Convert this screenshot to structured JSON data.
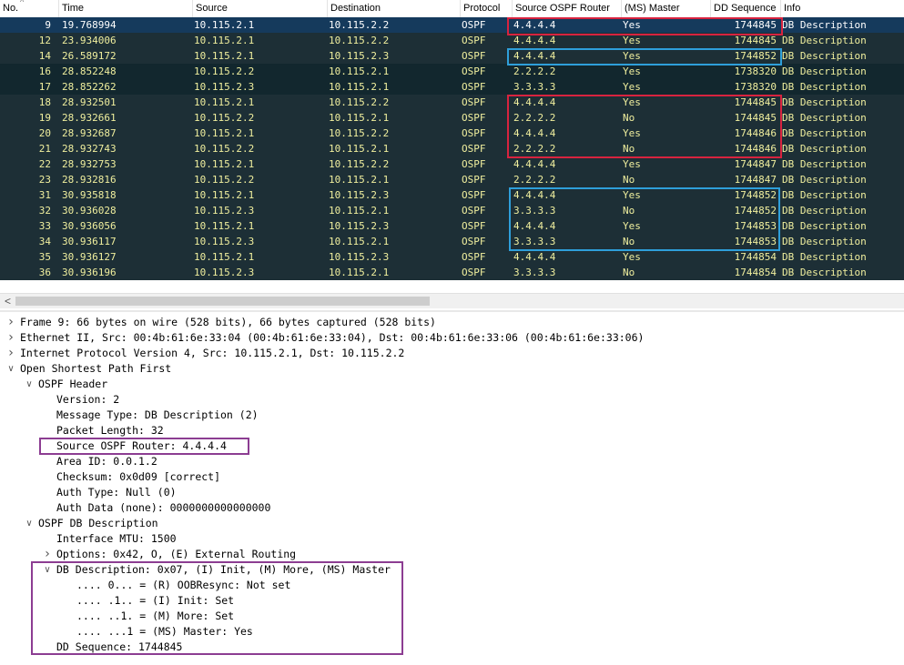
{
  "columns": [
    {
      "key": "no",
      "label": "No."
    },
    {
      "key": "time",
      "label": "Time"
    },
    {
      "key": "src",
      "label": "Source"
    },
    {
      "key": "dst",
      "label": "Destination"
    },
    {
      "key": "proto",
      "label": "Protocol"
    },
    {
      "key": "router",
      "label": "Source OSPF Router"
    },
    {
      "key": "master",
      "label": "(MS) Master"
    },
    {
      "key": "seq",
      "label": "DD Sequence"
    },
    {
      "key": "info",
      "label": "Info"
    }
  ],
  "packets": [
    {
      "no": "9",
      "time": "19.768994",
      "src": "10.115.2.1",
      "dst": "10.115.2.2",
      "proto": "OSPF",
      "router": "4.4.4.4",
      "master": "Yes",
      "seq": "1744845",
      "info": "DB Description",
      "style": "sel"
    },
    {
      "no": "12",
      "time": "23.934006",
      "src": "10.115.2.1",
      "dst": "10.115.2.2",
      "proto": "OSPF",
      "router": "4.4.4.4",
      "master": "Yes",
      "seq": "1744845",
      "info": "DB Description",
      "style": "mid"
    },
    {
      "no": "14",
      "time": "26.589172",
      "src": "10.115.2.1",
      "dst": "10.115.2.3",
      "proto": "OSPF",
      "router": "4.4.4.4",
      "master": "Yes",
      "seq": "1744852",
      "info": "DB Description",
      "style": "mid"
    },
    {
      "no": "16",
      "time": "28.852248",
      "src": "10.115.2.2",
      "dst": "10.115.2.1",
      "proto": "OSPF",
      "router": "2.2.2.2",
      "master": "Yes",
      "seq": "1738320",
      "info": "DB Description",
      "style": "dark"
    },
    {
      "no": "17",
      "time": "28.852262",
      "src": "10.115.2.3",
      "dst": "10.115.2.1",
      "proto": "OSPF",
      "router": "3.3.3.3",
      "master": "Yes",
      "seq": "1738320",
      "info": "DB Description",
      "style": "dark"
    },
    {
      "no": "18",
      "time": "28.932501",
      "src": "10.115.2.1",
      "dst": "10.115.2.2",
      "proto": "OSPF",
      "router": "4.4.4.4",
      "master": "Yes",
      "seq": "1744845",
      "info": "DB Description",
      "style": "mid"
    },
    {
      "no": "19",
      "time": "28.932661",
      "src": "10.115.2.2",
      "dst": "10.115.2.1",
      "proto": "OSPF",
      "router": "2.2.2.2",
      "master": "No",
      "seq": "1744845",
      "info": "DB Description",
      "style": "mid"
    },
    {
      "no": "20",
      "time": "28.932687",
      "src": "10.115.2.1",
      "dst": "10.115.2.2",
      "proto": "OSPF",
      "router": "4.4.4.4",
      "master": "Yes",
      "seq": "1744846",
      "info": "DB Description",
      "style": "mid"
    },
    {
      "no": "21",
      "time": "28.932743",
      "src": "10.115.2.2",
      "dst": "10.115.2.1",
      "proto": "OSPF",
      "router": "2.2.2.2",
      "master": "No",
      "seq": "1744846",
      "info": "DB Description",
      "style": "mid"
    },
    {
      "no": "22",
      "time": "28.932753",
      "src": "10.115.2.1",
      "dst": "10.115.2.2",
      "proto": "OSPF",
      "router": "4.4.4.4",
      "master": "Yes",
      "seq": "1744847",
      "info": "DB Description",
      "style": "mid"
    },
    {
      "no": "23",
      "time": "28.932816",
      "src": "10.115.2.2",
      "dst": "10.115.2.1",
      "proto": "OSPF",
      "router": "2.2.2.2",
      "master": "No",
      "seq": "1744847",
      "info": "DB Description",
      "style": "mid"
    },
    {
      "no": "31",
      "time": "30.935818",
      "src": "10.115.2.1",
      "dst": "10.115.2.3",
      "proto": "OSPF",
      "router": "4.4.4.4",
      "master": "Yes",
      "seq": "1744852",
      "info": "DB Description",
      "style": "mid"
    },
    {
      "no": "32",
      "time": "30.936028",
      "src": "10.115.2.3",
      "dst": "10.115.2.1",
      "proto": "OSPF",
      "router": "3.3.3.3",
      "master": "No",
      "seq": "1744852",
      "info": "DB Description",
      "style": "mid"
    },
    {
      "no": "33",
      "time": "30.936056",
      "src": "10.115.2.1",
      "dst": "10.115.2.3",
      "proto": "OSPF",
      "router": "4.4.4.4",
      "master": "Yes",
      "seq": "1744853",
      "info": "DB Description",
      "style": "mid"
    },
    {
      "no": "34",
      "time": "30.936117",
      "src": "10.115.2.3",
      "dst": "10.115.2.1",
      "proto": "OSPF",
      "router": "3.3.3.3",
      "master": "No",
      "seq": "1744853",
      "info": "DB Description",
      "style": "mid"
    },
    {
      "no": "35",
      "time": "30.936127",
      "src": "10.115.2.1",
      "dst": "10.115.2.3",
      "proto": "OSPF",
      "router": "4.4.4.4",
      "master": "Yes",
      "seq": "1744854",
      "info": "DB Description",
      "style": "mid"
    },
    {
      "no": "36",
      "time": "30.936196",
      "src": "10.115.2.3",
      "dst": "10.115.2.1",
      "proto": "OSPF",
      "router": "3.3.3.3",
      "master": "No",
      "seq": "1744854",
      "info": "DB Description",
      "style": "mid"
    }
  ],
  "details": [
    {
      "text": "Frame 9: 66 bytes on wire (528 bits), 66 bytes captured (528 bits)",
      "level": 0,
      "toggle": "collapsed"
    },
    {
      "text": "Ethernet II, Src: 00:4b:61:6e:33:04 (00:4b:61:6e:33:04), Dst: 00:4b:61:6e:33:06 (00:4b:61:6e:33:06)",
      "level": 0,
      "toggle": "collapsed"
    },
    {
      "text": "Internet Protocol Version 4, Src: 10.115.2.1, Dst: 10.115.2.2",
      "level": 0,
      "toggle": "collapsed"
    },
    {
      "text": "Open Shortest Path First",
      "level": 0,
      "toggle": "expanded"
    },
    {
      "text": "OSPF Header",
      "level": 1,
      "toggle": "expanded"
    },
    {
      "text": "Version: 2",
      "level": 2,
      "toggle": ""
    },
    {
      "text": "Message Type: DB Description (2)",
      "level": 2,
      "toggle": ""
    },
    {
      "text": "Packet Length: 32",
      "level": 2,
      "toggle": ""
    },
    {
      "text": "Source OSPF Router: 4.4.4.4",
      "level": 2,
      "toggle": ""
    },
    {
      "text": "Area ID: 0.0.1.2",
      "level": 2,
      "toggle": ""
    },
    {
      "text": "Checksum: 0x0d09 [correct]",
      "level": 2,
      "toggle": ""
    },
    {
      "text": "Auth Type: Null (0)",
      "level": 2,
      "toggle": ""
    },
    {
      "text": "Auth Data (none): 0000000000000000",
      "level": 2,
      "toggle": ""
    },
    {
      "text": "OSPF DB Description",
      "level": 1,
      "toggle": "expanded"
    },
    {
      "text": "Interface MTU: 1500",
      "level": 2,
      "toggle": ""
    },
    {
      "text": "Options: 0x42, O, (E) External Routing",
      "level": 2,
      "toggle": "collapsed"
    },
    {
      "text": "DB Description: 0x07, (I) Init, (M) More, (MS) Master",
      "level": 2,
      "toggle": "expanded"
    },
    {
      "text": ".... 0... = (R) OOBResync: Not set",
      "level": 3,
      "toggle": ""
    },
    {
      "text": ".... .1.. = (I) Init: Set",
      "level": 3,
      "toggle": ""
    },
    {
      "text": ".... ..1. = (M) More: Set",
      "level": 3,
      "toggle": ""
    },
    {
      "text": ".... ...1 = (MS) Master: Yes",
      "level": 3,
      "toggle": ""
    },
    {
      "text": "DD Sequence: 1744845",
      "level": 2,
      "toggle": ""
    }
  ],
  "scrollbar": {
    "left_arrow": "<"
  },
  "colors": {
    "highlight_red": "#d8233f",
    "highlight_blue": "#2e9fda",
    "highlight_purple": "#8c3d92",
    "row_bg": "#1d2f36",
    "row_text": "#f0ef9e",
    "selected_bg": "#153a5c"
  }
}
